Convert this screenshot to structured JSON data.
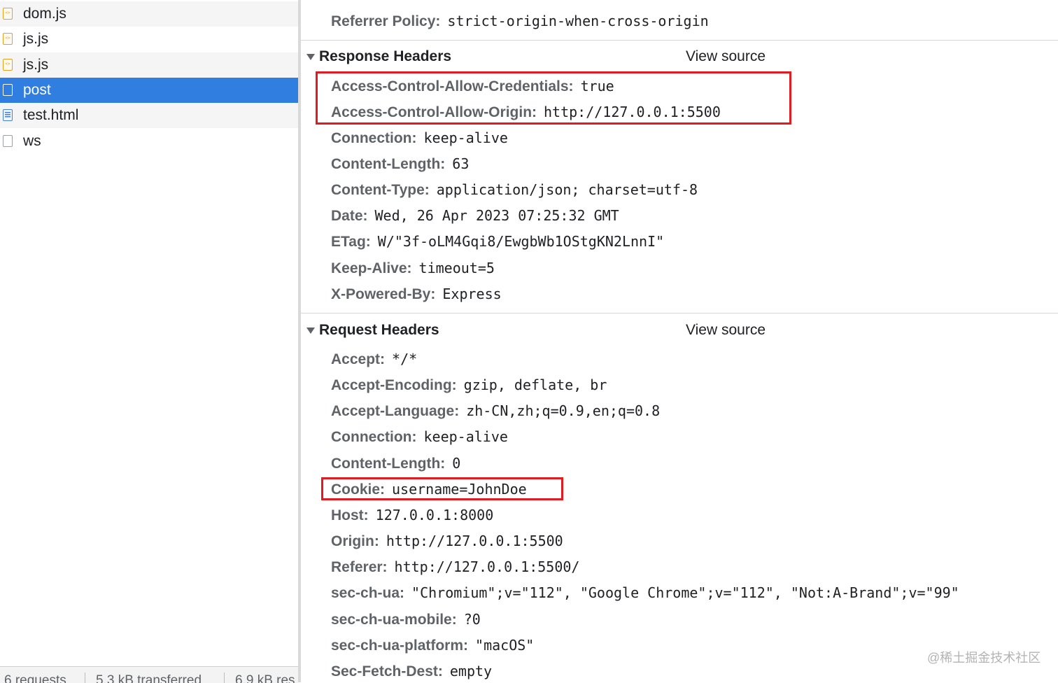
{
  "requests": [
    {
      "name": "dom.js",
      "type": "js"
    },
    {
      "name": "js.js",
      "type": "js"
    },
    {
      "name": "js.js",
      "type": "js"
    },
    {
      "name": "post",
      "type": "doc",
      "selected": true
    },
    {
      "name": "test.html",
      "type": "html"
    },
    {
      "name": "ws",
      "type": "doc"
    }
  ],
  "status_bar": {
    "requests": "6 requests",
    "transferred": "5.3 kB transferred",
    "resources": "6.9 kB res"
  },
  "general": {
    "referrer_policy_key": "Referrer Policy:",
    "referrer_policy_value": "strict-origin-when-cross-origin"
  },
  "response_headers": {
    "title": "Response Headers",
    "view_source": "View source",
    "items": [
      {
        "key": "Access-Control-Allow-Credentials:",
        "value": "true"
      },
      {
        "key": "Access-Control-Allow-Origin:",
        "value": "http://127.0.0.1:5500"
      },
      {
        "key": "Connection:",
        "value": "keep-alive"
      },
      {
        "key": "Content-Length:",
        "value": "63"
      },
      {
        "key": "Content-Type:",
        "value": "application/json; charset=utf-8"
      },
      {
        "key": "Date:",
        "value": "Wed, 26 Apr 2023 07:25:32 GMT"
      },
      {
        "key": "ETag:",
        "value": "W/\"3f-oLM4Gqi8/EwgbWb1OStgKN2LnnI\""
      },
      {
        "key": "Keep-Alive:",
        "value": "timeout=5"
      },
      {
        "key": "X-Powered-By:",
        "value": "Express"
      }
    ]
  },
  "request_headers": {
    "title": "Request Headers",
    "view_source": "View source",
    "items": [
      {
        "key": "Accept:",
        "value": "*/*"
      },
      {
        "key": "Accept-Encoding:",
        "value": "gzip, deflate, br"
      },
      {
        "key": "Accept-Language:",
        "value": "zh-CN,zh;q=0.9,en;q=0.8"
      },
      {
        "key": "Connection:",
        "value": "keep-alive"
      },
      {
        "key": "Content-Length:",
        "value": "0"
      },
      {
        "key": "Cookie:",
        "value": "username=JohnDoe"
      },
      {
        "key": "Host:",
        "value": "127.0.0.1:8000"
      },
      {
        "key": "Origin:",
        "value": "http://127.0.0.1:5500"
      },
      {
        "key": "Referer:",
        "value": "http://127.0.0.1:5500/"
      },
      {
        "key": "sec-ch-ua:",
        "value": "\"Chromium\";v=\"112\", \"Google Chrome\";v=\"112\", \"Not:A-Brand\";v=\"99\""
      },
      {
        "key": "sec-ch-ua-mobile:",
        "value": "?0"
      },
      {
        "key": "sec-ch-ua-platform:",
        "value": "\"macOS\""
      },
      {
        "key": "Sec-Fetch-Dest:",
        "value": "empty"
      }
    ]
  },
  "highlight_color": "#e11b22",
  "selected_color": "#2f7ee0",
  "watermark": "@稀土掘金技术社区"
}
